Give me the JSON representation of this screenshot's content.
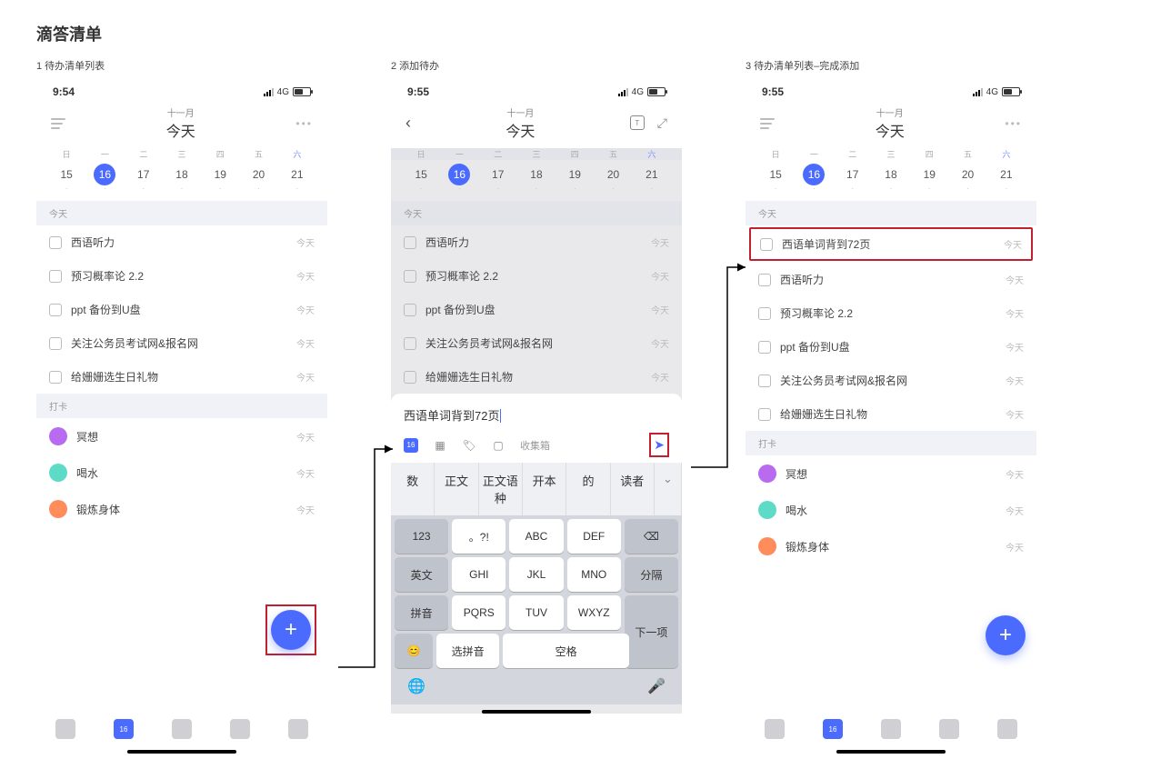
{
  "page_title": "滴答清单",
  "screens": {
    "s1": {
      "caption": "1 待办清单列表",
      "time": "9:54",
      "network": "4G",
      "month": "十一月",
      "today_label": "今天",
      "weeknames": [
        "日",
        "一",
        "二",
        "三",
        "四",
        "五",
        "六"
      ],
      "days": [
        "15",
        "16",
        "17",
        "18",
        "19",
        "20",
        "21"
      ],
      "section_today": "今天",
      "tasks": [
        {
          "label": "西语听力",
          "due": "今天"
        },
        {
          "label": "预习概率论 2.2",
          "due": "今天"
        },
        {
          "label": "ppt 备份到U盘",
          "due": "今天"
        },
        {
          "label": "关注公务员考试网&报名网",
          "due": "今天"
        },
        {
          "label": "给姗姗选生日礼物",
          "due": "今天"
        }
      ],
      "section_habit": "打卡",
      "habits": [
        {
          "label": "冥想",
          "due": "今天"
        },
        {
          "label": "喝水",
          "due": "今天"
        },
        {
          "label": "锻炼身体",
          "due": "今天"
        }
      ],
      "tab_date": "16"
    },
    "s2": {
      "caption": "2 添加待办",
      "time": "9:55",
      "network": "4G",
      "month": "十一月",
      "today_label": "今天",
      "weeknames": [
        "日",
        "一",
        "二",
        "三",
        "四",
        "五",
        "六"
      ],
      "days": [
        "15",
        "16",
        "17",
        "18",
        "19",
        "20",
        "21"
      ],
      "section_today": "今天",
      "tasks": [
        {
          "label": "西语听力",
          "due": "今天"
        },
        {
          "label": "预习概率论 2.2",
          "due": "今天"
        },
        {
          "label": "ppt 备份到U盘",
          "due": "今天"
        },
        {
          "label": "关注公务员考试网&报名网",
          "due": "今天"
        },
        {
          "label": "给姗姗选生日礼物",
          "due": "今天"
        }
      ],
      "input_text": "西语单词背到72页",
      "inbox_label": "收集箱",
      "date_badge": "16",
      "suggestions": [
        "数",
        "正文",
        "正文语种",
        "开本",
        "的",
        "读者"
      ],
      "keyboard": {
        "r1": [
          "123",
          "。?!",
          "ABC",
          "DEF",
          "⌫"
        ],
        "r2": [
          "英文",
          "GHI",
          "JKL",
          "MNO",
          "分隔"
        ],
        "r3": [
          "拼音",
          "PQRS",
          "TUV",
          "WXYZ",
          ""
        ],
        "r4": [
          "😊",
          "选拼音",
          "空格",
          "下一项"
        ]
      }
    },
    "s3": {
      "caption": "3 待办清单列表–完成添加",
      "time": "9:55",
      "network": "4G",
      "month": "十一月",
      "today_label": "今天",
      "weeknames": [
        "日",
        "一",
        "二",
        "三",
        "四",
        "五",
        "六"
      ],
      "days": [
        "15",
        "16",
        "17",
        "18",
        "19",
        "20",
        "21"
      ],
      "section_today": "今天",
      "new_task": {
        "label": "西语单词背到72页",
        "due": "今天"
      },
      "tasks": [
        {
          "label": "西语听力",
          "due": "今天"
        },
        {
          "label": "预习概率论 2.2",
          "due": "今天"
        },
        {
          "label": "ppt 备份到U盘",
          "due": "今天"
        },
        {
          "label": "关注公务员考试网&报名网",
          "due": "今天"
        },
        {
          "label": "给姗姗选生日礼物",
          "due": "今天"
        }
      ],
      "section_habit": "打卡",
      "habits": [
        {
          "label": "冥想",
          "due": "今天"
        },
        {
          "label": "喝水",
          "due": "今天"
        },
        {
          "label": "锻炼身体",
          "due": "今天"
        }
      ],
      "tab_date": "16"
    }
  }
}
